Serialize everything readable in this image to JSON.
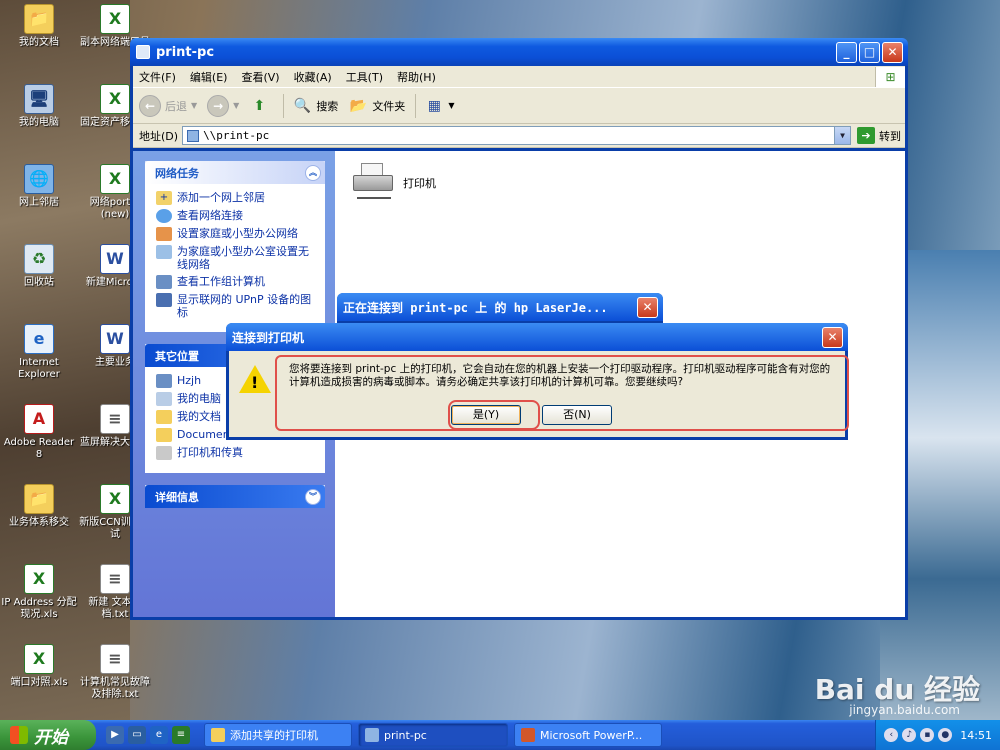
{
  "desktop": {
    "icons": [
      {
        "label": "我的文档",
        "glyph": "📁"
      },
      {
        "label": "副本网络端口号",
        "glyph": "X"
      },
      {
        "label": "我的电脑",
        "glyph": "🖥"
      },
      {
        "label": "固定资产移交书",
        "glyph": "X"
      },
      {
        "label": "网上邻居",
        "glyph": "🌐"
      },
      {
        "label": "网络port号(new)",
        "glyph": "X"
      },
      {
        "label": "回收站",
        "glyph": "♻"
      },
      {
        "label": "新建Microso",
        "glyph": "W"
      },
      {
        "label": "Internet Explorer",
        "glyph": "e"
      },
      {
        "label": "主要业务",
        "glyph": "W"
      },
      {
        "label": "Adobe Reader 8",
        "glyph": "A"
      },
      {
        "label": "蓝屏解决大合集",
        "glyph": "≡"
      },
      {
        "label": "业务体系移交",
        "glyph": "📁"
      },
      {
        "label": "新版CCN训、考试",
        "glyph": "X"
      },
      {
        "label": "IP Address 分配现况.xls",
        "glyph": "X"
      },
      {
        "label": "新建 文本文档.txt",
        "glyph": "≡"
      },
      {
        "label": "端口对照.xls",
        "glyph": "X"
      },
      {
        "label": "计算机常见故障及排除.txt",
        "glyph": "≡"
      }
    ]
  },
  "explorer": {
    "title": "print-pc",
    "window_buttons": {
      "minimize": "_",
      "maximize": "□",
      "close": "✕"
    },
    "menu": [
      "文件(F)",
      "编辑(E)",
      "查看(V)",
      "收藏(A)",
      "工具(T)",
      "帮助(H)"
    ],
    "toolbar": {
      "back": "后退",
      "forward": "",
      "up": "",
      "search": "搜索",
      "folders": "文件夹",
      "views": ""
    },
    "address": {
      "label": "地址(D)",
      "value": "\\\\print-pc",
      "go": "转到"
    },
    "taskpane": {
      "network_tasks": {
        "title": "网络任务",
        "items": [
          "添加一个网上邻居",
          "查看网络连接",
          "设置家庭或小型办公网络",
          "为家庭或小型办公室设置无线网络",
          "查看工作组计算机",
          "显示联网的 UPnP 设备的图标"
        ]
      },
      "other_places": {
        "title": "其它位置",
        "items": [
          "Hzjh",
          "我的电脑",
          "我的文档",
          "Documents",
          "打印机和传真"
        ]
      },
      "details": {
        "title": "详细信息"
      }
    },
    "content": {
      "printer_label": "打印机"
    }
  },
  "dialog_behind": {
    "title": "正在连接到 print-pc 上 的 hp LaserJe...",
    "close": "✕"
  },
  "dialog": {
    "title": "连接到打印机",
    "close": "✕",
    "message": "您将要连接到 print-pc 上的打印机，它会自动在您的机器上安装一个打印驱动程序。打印机驱动程序可能含有对您的计算机造成损害的病毒或脚本。请务必确定共享该打印机的计算机可靠。您要继续吗?",
    "yes": "是(Y)",
    "no": "否(N)"
  },
  "taskbar": {
    "start": "开始",
    "tasks": [
      "添加共享的打印机",
      "print-pc",
      "Microsoft PowerP..."
    ],
    "clock": "14:51"
  },
  "watermark": {
    "brand": "Bai du 经验",
    "url": "jingyan.baidu.com"
  }
}
